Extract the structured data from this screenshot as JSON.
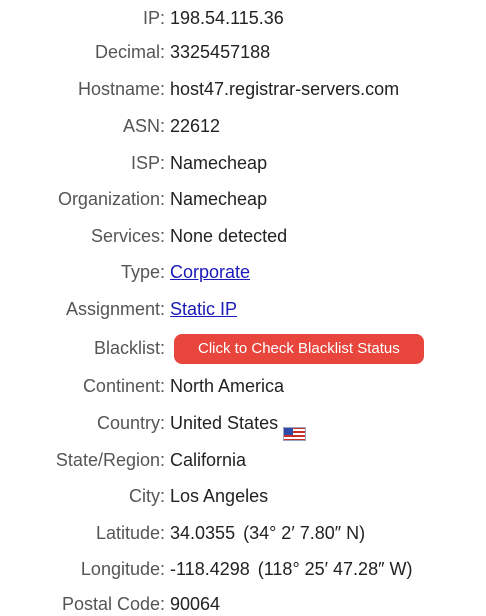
{
  "rows": {
    "ip": {
      "label": "IP",
      "value": "198.54.115.36"
    },
    "decimal": {
      "label": "Decimal",
      "value": "3325457188"
    },
    "hostname": {
      "label": "Hostname",
      "value": "host47.registrar-servers.com"
    },
    "asn": {
      "label": "ASN",
      "value": "22612"
    },
    "isp": {
      "label": "ISP",
      "value": "Namecheap"
    },
    "organization": {
      "label": "Organization",
      "value": "Namecheap"
    },
    "services": {
      "label": "Services",
      "value": "None detected"
    },
    "type": {
      "label": "Type",
      "value": "Corporate"
    },
    "assignment": {
      "label": "Assignment",
      "value": "Static IP"
    },
    "blacklist": {
      "label": "Blacklist",
      "button_label": "Click to Check Blacklist Status"
    },
    "continent": {
      "label": "Continent",
      "value": "North America"
    },
    "country": {
      "label": "Country",
      "value": "United States",
      "flag_icon": "us-flag-icon"
    },
    "state": {
      "label": "State/Region",
      "value": "California"
    },
    "city": {
      "label": "City",
      "value": "Los Angeles"
    },
    "latitude": {
      "label": "Latitude",
      "value": "34.0355",
      "dms": "(34° 2′ 7.80″ N)"
    },
    "longitude": {
      "label": "Longitude",
      "value": "-118.4298",
      "dms": "(118° 25′ 47.28″ W)"
    },
    "postal": {
      "label": "Postal Code",
      "value": "90064"
    }
  },
  "colors": {
    "label": "#555555",
    "value": "#222222",
    "link": "#1a1ab8",
    "button_bg": "#e8453c",
    "button_text": "#ffffff"
  }
}
